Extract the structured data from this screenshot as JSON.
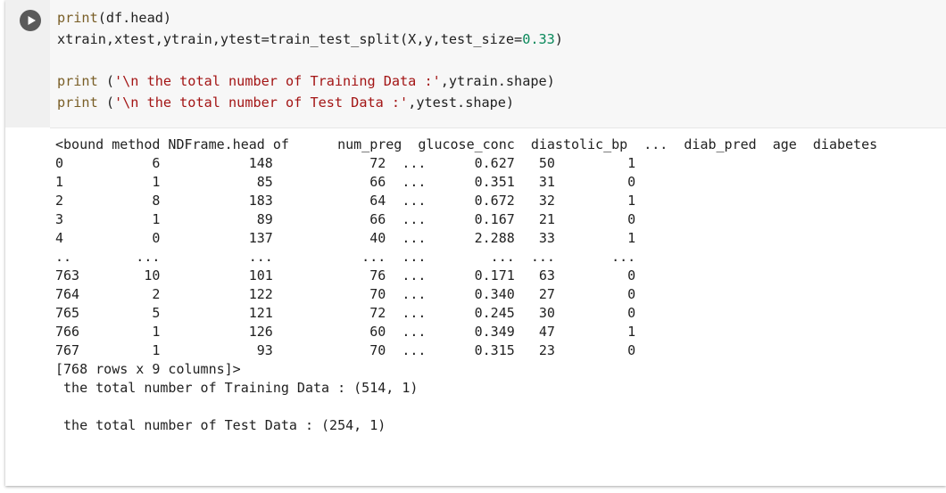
{
  "cell": {
    "run_button_icon": "play-icon",
    "code_lines": [
      {
        "kind": "plain",
        "parts": [
          {
            "t": "print",
            "c": "kw"
          },
          {
            "t": "(df.head)",
            "c": ""
          }
        ]
      },
      {
        "kind": "plain",
        "parts": [
          {
            "t": "xtrain,xtest,ytrain,ytest=train_test_split(X,y,test_size=",
            "c": ""
          },
          {
            "t": "0.33",
            "c": "num"
          },
          {
            "t": ")",
            "c": ""
          }
        ]
      },
      {
        "kind": "blank",
        "parts": []
      },
      {
        "kind": "plain",
        "parts": [
          {
            "t": "print",
            "c": "kw"
          },
          {
            "t": " (",
            "c": ""
          },
          {
            "t": "'\\n the total number of Training Data :'",
            "c": "str"
          },
          {
            "t": ",ytrain.shape)",
            "c": ""
          }
        ]
      },
      {
        "kind": "plain",
        "parts": [
          {
            "t": "print",
            "c": "kw"
          },
          {
            "t": " (",
            "c": ""
          },
          {
            "t": "'\\n the total number of Test Data :'",
            "c": "str"
          },
          {
            "t": ",ytest.shape)",
            "c": ""
          }
        ]
      }
    ]
  },
  "output": {
    "dataframe_header": "<bound method NDFrame.head of      num_preg  glucose_conc  diastolic_bp  ...  diab_pred  age  diabetes",
    "dataframe_rows": [
      "0           6           148            72  ...      0.627   50         1",
      "1           1            85            66  ...      0.351   31         0",
      "2           8           183            64  ...      0.672   32         1",
      "3           1            89            66  ...      0.167   21         0",
      "4           0           137            40  ...      2.288   33         1",
      "..        ...           ...           ...  ...        ...  ...       ...",
      "763        10           101            76  ...      0.171   63         0",
      "764         2           122            70  ...      0.340   27         0",
      "765         5           121            72  ...      0.245   30         0",
      "766         1           126            60  ...      0.349   47         1",
      "767         1            93            70  ...      0.315   23         0"
    ],
    "dataframe_footer": "[768 rows x 9 columns]>",
    "training_shape_line": " the total number of Training Data : (514, 1)",
    "test_shape_line": " the total number of Test Data : (254, 1)"
  }
}
